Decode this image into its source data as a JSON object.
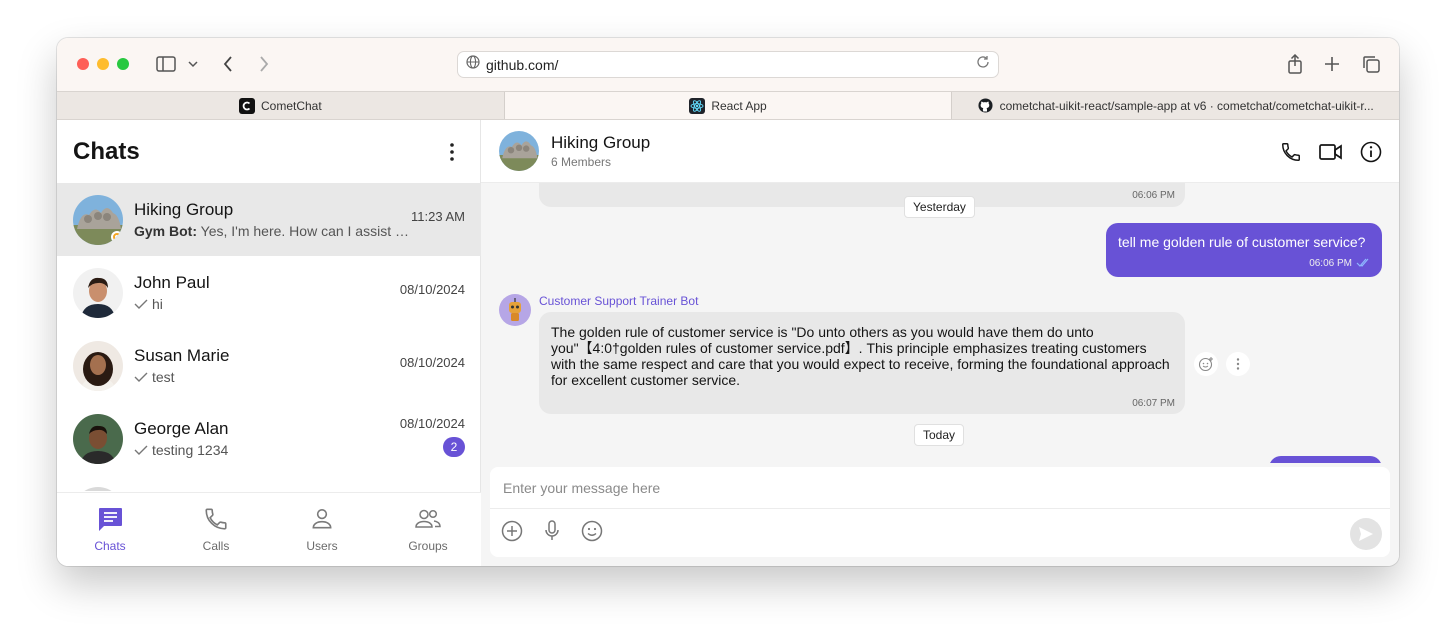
{
  "browser": {
    "url": "github.com/",
    "tabs": [
      {
        "label": "CometChat",
        "active": false
      },
      {
        "label": "React App",
        "active": true
      },
      {
        "label": "cometchat-uikit-react/sample-app at v6 · cometchat/cometchat-uikit-r...",
        "active": false
      }
    ]
  },
  "sidebar": {
    "title": "Chats",
    "chats": [
      {
        "name": "Hiking Group",
        "sender": "Gym Bot:",
        "preview": "Yes, I'm here. How can I assist yo...",
        "time": "11:23 AM"
      },
      {
        "name": "John Paul",
        "preview": "hi",
        "time": "08/10/2024"
      },
      {
        "name": "Susan Marie",
        "preview": "test",
        "time": "08/10/2024"
      },
      {
        "name": "George Alan",
        "preview": "testing 1234",
        "time": "08/10/2024",
        "unread": "2"
      }
    ],
    "nav": [
      {
        "label": "Chats"
      },
      {
        "label": "Calls"
      },
      {
        "label": "Users"
      },
      {
        "label": "Groups"
      }
    ]
  },
  "conversation": {
    "title": "Hiking Group",
    "subtitle": "6 Members",
    "messages": {
      "first_time": "06:06 PM",
      "date_yesterday": "Yesterday",
      "outgoing_text": "tell me golden rule of customer service?",
      "outgoing_time": "06:06 PM",
      "bot_name": "Customer Support Trainer Bot",
      "bot_text": "The golden rule of customer service is \"Do unto others as you would have them do unto you\"【4:0†golden rules of customer service.pdf】. This principle emphasizes treating customers with the same respect and care that you would expect to receive, forming the foundational approach for excellent customer service.",
      "bot_time": "06:07 PM",
      "date_today": "Today"
    },
    "composer": {
      "placeholder": "Enter your message here"
    }
  },
  "colors": {
    "accent": "#6852d6",
    "incoming_bubble": "#e8e8e8",
    "status_away": "#f5a623"
  }
}
